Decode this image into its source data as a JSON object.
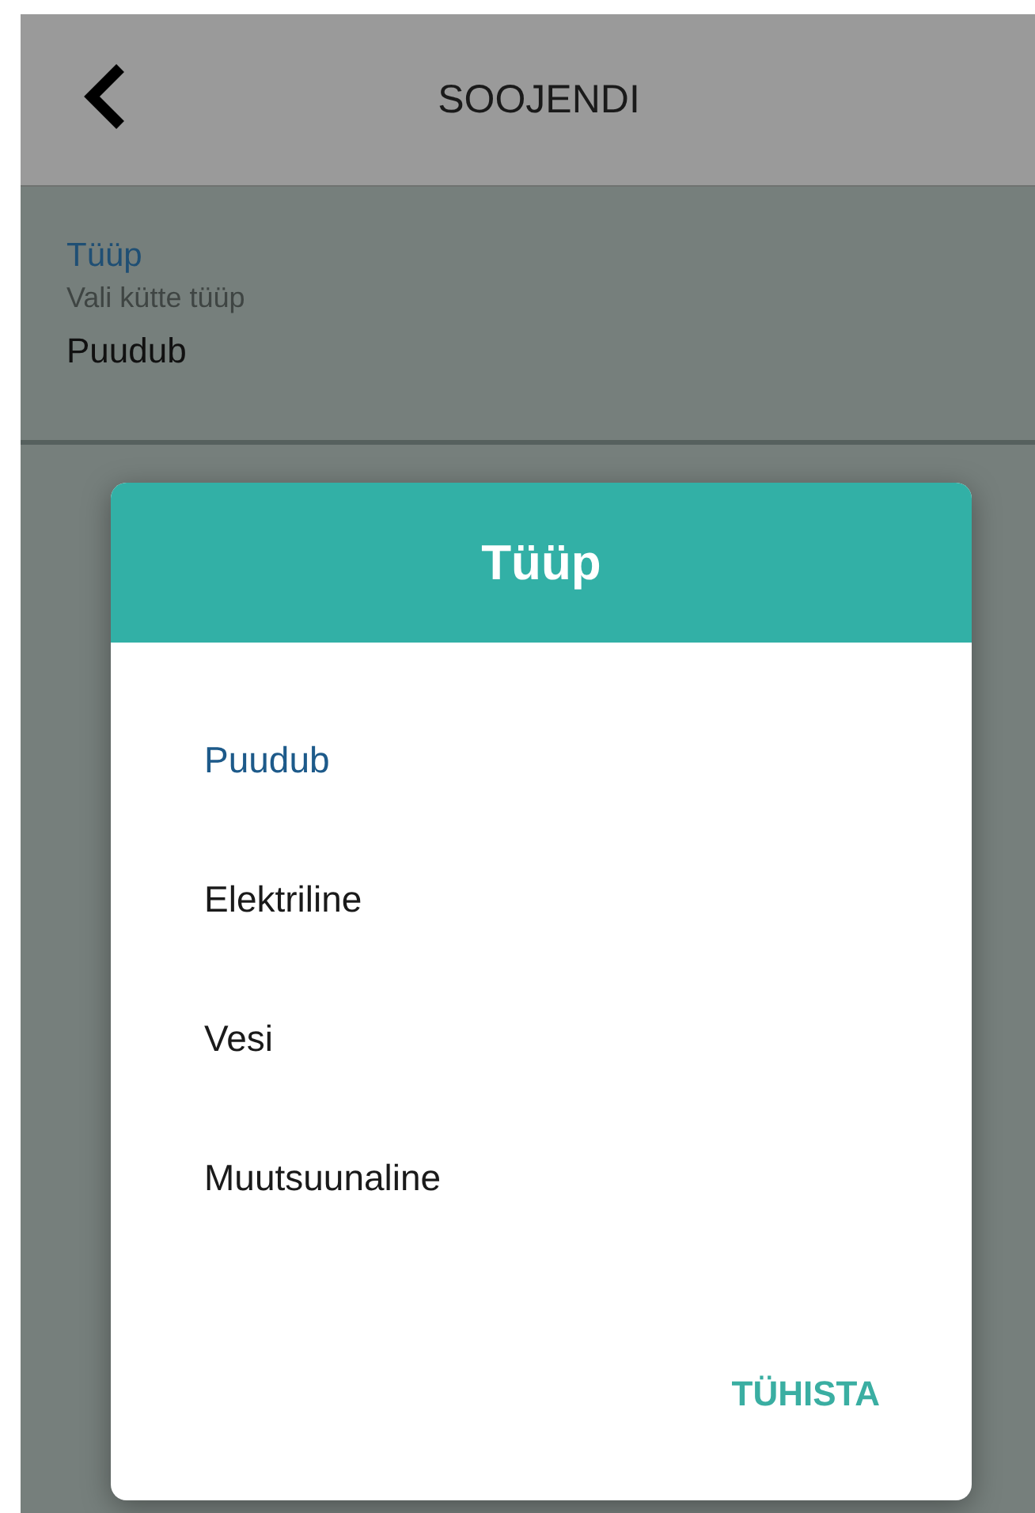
{
  "header": {
    "title": "SOOJENDI"
  },
  "setting": {
    "label": "Tüüp",
    "hint": "Vali kütte tüüp",
    "value": "Puudub"
  },
  "dialog": {
    "title": "Tüüp",
    "options": [
      {
        "label": "Puudub",
        "selected": true
      },
      {
        "label": "Elektriline",
        "selected": false
      },
      {
        "label": "Vesi",
        "selected": false
      },
      {
        "label": "Muutsuunaline",
        "selected": false
      }
    ],
    "cancel": "TÜHISTA"
  }
}
